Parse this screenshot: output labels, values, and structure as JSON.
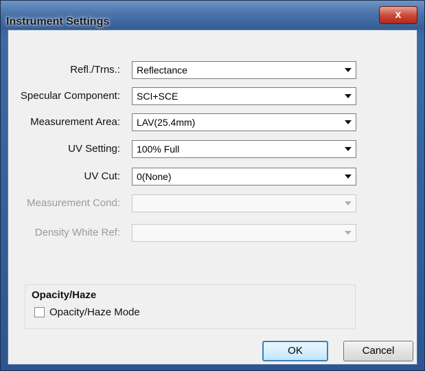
{
  "window": {
    "title": "Instrument Settings",
    "close_glyph": "x"
  },
  "fields": [
    {
      "label": "Refl./Trns.:",
      "value": "Reflectance",
      "enabled": true
    },
    {
      "label": "Specular Component:",
      "value": "SCI+SCE",
      "enabled": true
    },
    {
      "label": "Measurement Area:",
      "value": "LAV(25.4mm)",
      "enabled": true
    },
    {
      "label": "UV Setting:",
      "value": "100% Full",
      "enabled": true
    },
    {
      "label": "UV Cut:",
      "value": "0(None)",
      "enabled": true
    },
    {
      "label": "Measurement Cond:",
      "value": "",
      "enabled": false
    },
    {
      "label": "Density White Ref:",
      "value": "",
      "enabled": false
    }
  ],
  "opacity_group": {
    "title": "Opacity/Haze",
    "checkbox_label": "Opacity/Haze Mode",
    "checked": false
  },
  "buttons": {
    "ok": "OK",
    "cancel": "Cancel"
  },
  "colors": {
    "title_bar": "#4a74ab",
    "close_button": "#cd4a3a",
    "dialog_bg": "#f0f0f0",
    "default_button_border": "#3c7fb1",
    "disabled_text": "#9a9a9a"
  }
}
